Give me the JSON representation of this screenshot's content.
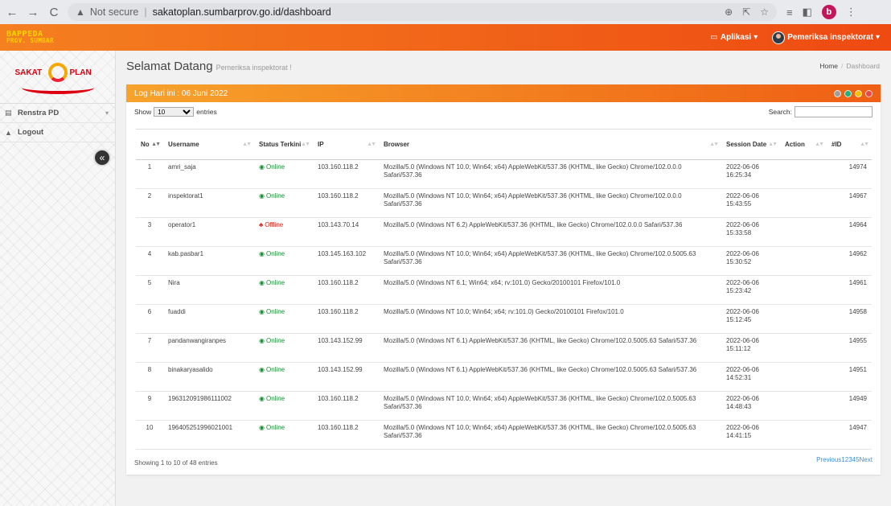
{
  "browser": {
    "security": "Not secure",
    "url": "sakatoplan.sumbarprov.go.id/dashboard",
    "profile_initial": "b"
  },
  "topbar": {
    "brand_line1": "BAPPEDA",
    "brand_line2": "PROV. SUMBAR",
    "apps_label": "Aplikasi",
    "user_label": "Pemeriksa inspektorat"
  },
  "sidebar": {
    "logo_left": "SAKAT",
    "logo_right": "PLAN",
    "items": [
      {
        "label": "Renstra PD",
        "icon": "book-icon"
      },
      {
        "label": "Logout",
        "icon": "lock-icon"
      }
    ],
    "collapse_glyph": "«"
  },
  "header": {
    "title": "Selamat Datang",
    "subtitle": "Pemeriksa inspektorat !",
    "breadcrumb": [
      "Home",
      "Dashboard"
    ]
  },
  "panel": {
    "title": "Log Hari ini : 06 Juni 2022",
    "tool_colors": [
      "#9e9e9e",
      "#20b27a",
      "#f6c000",
      "#ee4545"
    ]
  },
  "table_controls": {
    "show_label": "Show",
    "length_value": "10",
    "entries_label": "entries",
    "search_label": "Search:"
  },
  "table": {
    "columns": [
      "No",
      "Username",
      "Status Terkini",
      "IP",
      "Browser",
      "Session Date",
      "Action",
      "#ID"
    ],
    "rows": [
      {
        "no": "1",
        "username": "amri_saja",
        "status": "Online",
        "ip": "103.160.118.2",
        "browser": "Mozilla/5.0 (Windows NT 10.0; Win64; x64) AppleWebKit/537.36 (KHTML, like Gecko) Chrome/102.0.0.0 Safari/537.36",
        "date": "2022-06-06",
        "time": "16:25:34",
        "id": "14974"
      },
      {
        "no": "2",
        "username": "inspektorat1",
        "status": "Online",
        "ip": "103.160.118.2",
        "browser": "Mozilla/5.0 (Windows NT 10.0; Win64; x64) AppleWebKit/537.36 (KHTML, like Gecko) Chrome/102.0.0.0 Safari/537.36",
        "date": "2022-06-06",
        "time": "15:43:55",
        "id": "14967"
      },
      {
        "no": "3",
        "username": "operator1",
        "status": "Offline",
        "ip": "103.143.70.14",
        "browser": "Mozilla/5.0 (Windows NT 6.2) AppleWebKit/537.36 (KHTML, like Gecko) Chrome/102.0.0.0 Safari/537.36",
        "date": "2022-06-06",
        "time": "15:33:58",
        "id": "14964"
      },
      {
        "no": "4",
        "username": "kab.pasbar1",
        "status": "Online",
        "ip": "103.145.163.102",
        "browser": "Mozilla/5.0 (Windows NT 10.0; Win64; x64) AppleWebKit/537.36 (KHTML, like Gecko) Chrome/102.0.5005.63 Safari/537.36",
        "date": "2022-06-06",
        "time": "15:30:52",
        "id": "14962"
      },
      {
        "no": "5",
        "username": "Nira",
        "status": "Online",
        "ip": "103.160.118.2",
        "browser": "Mozilla/5.0 (Windows NT 6.1; Win64; x64; rv:101.0) Gecko/20100101 Firefox/101.0",
        "date": "2022-06-06",
        "time": "15:23:42",
        "id": "14961"
      },
      {
        "no": "6",
        "username": "fuaddi",
        "status": "Online",
        "ip": "103.160.118.2",
        "browser": "Mozilla/5.0 (Windows NT 10.0; Win64; x64; rv:101.0) Gecko/20100101 Firefox/101.0",
        "date": "2022-06-06",
        "time": "15:12:45",
        "id": "14958"
      },
      {
        "no": "7",
        "username": "pandanwangiranpes",
        "status": "Online",
        "ip": "103.143.152.99",
        "browser": "Mozilla/5.0 (Windows NT 6.1) AppleWebKit/537.36 (KHTML, like Gecko) Chrome/102.0.5005.63 Safari/537.36",
        "date": "2022-06-06",
        "time": "15:11:12",
        "id": "14955"
      },
      {
        "no": "8",
        "username": "binakaryasalido",
        "status": "Online",
        "ip": "103.143.152.99",
        "browser": "Mozilla/5.0 (Windows NT 6.1) AppleWebKit/537.36 (KHTML, like Gecko) Chrome/102.0.5005.63 Safari/537.36",
        "date": "2022-06-06",
        "time": "14:52:31",
        "id": "14951"
      },
      {
        "no": "9",
        "username": "196312091986111002",
        "status": "Online",
        "ip": "103.160.118.2",
        "browser": "Mozilla/5.0 (Windows NT 10.0; Win64; x64) AppleWebKit/537.36 (KHTML, like Gecko) Chrome/102.0.5005.63 Safari/537.36",
        "date": "2022-06-06",
        "time": "14:48:43",
        "id": "14949"
      },
      {
        "no": "10",
        "username": "196405251996021001",
        "status": "Online",
        "ip": "103.160.118.2",
        "browser": "Mozilla/5.0 (Windows NT 10.0; Win64; x64) AppleWebKit/537.36 (KHTML, like Gecko) Chrome/102.0.5005.63 Safari/537.36",
        "date": "2022-06-06",
        "time": "14:41:15",
        "id": "14947"
      }
    ]
  },
  "footer": {
    "info": "Showing 1 to 10 of 48 entries",
    "pages": [
      "Previous",
      "1",
      "2",
      "3",
      "4",
      "5",
      "Next"
    ]
  },
  "colors": {
    "online": "#1e8a3a",
    "offline": "#d6261b",
    "topbar_start": "#f48020",
    "topbar_end": "#ee4a12"
  }
}
